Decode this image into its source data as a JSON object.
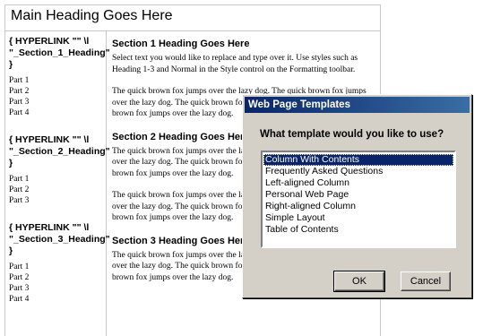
{
  "document": {
    "main_heading": "Main Heading Goes Here",
    "nav_groups": [
      {
        "link": "{ HYPERLINK \"\" \\l \"_Section_1_Heading\" }",
        "parts": [
          "Part 1",
          "Part 2",
          "Part 3",
          "Part 4"
        ]
      },
      {
        "link": "{ HYPERLINK \"\" \\l \"_Section_2_Heading\" }",
        "parts": [
          "Part 1",
          "Part 2",
          "Part 3"
        ]
      },
      {
        "link": "{ HYPERLINK \"\" \\l \"_Section_3_Heading\" }",
        "parts": [
          "Part 1",
          "Part 2",
          "Part 3",
          "Part 4"
        ]
      }
    ],
    "sections": [
      {
        "heading": "Section 1 Heading Goes Here",
        "paragraphs": [
          "Select text you would like to replace and type over it. Use styles such as Heading 1-3 and Normal in the Style control on the Formatting toolbar.",
          "The quick brown fox jumps over the lazy dog. The quick brown fox jumps over the lazy dog. The quick brown fox jumps over the lazy dog. The quick brown fox jumps over the lazy dog."
        ]
      },
      {
        "heading": "Section 2 Heading Goes Here",
        "paragraphs": [
          "The quick brown fox jumps over the lazy dog. The quick brown fox jumps over the lazy dog. The quick brown fox jumps over the lazy dog. The quick brown fox jumps over the lazy dog.",
          "The quick brown fox jumps over the lazy dog. The quick brown fox jumps over the lazy dog. The quick brown fox jumps over the lazy dog. The quick brown fox jumps over the lazy dog."
        ]
      },
      {
        "heading": "Section 3 Heading Goes Here",
        "paragraphs": [
          "The quick brown fox jumps over the lazy dog. The quick brown fox jumps over the lazy dog. The quick brown fox jumps over the lazy dog. The quick brown fox jumps over the lazy dog."
        ]
      }
    ]
  },
  "dialog": {
    "title": "Web Page Templates",
    "prompt": "What template would you like to use?",
    "templates": [
      "Column With Contents",
      "Frequently Asked Questions",
      "Left-aligned Column",
      "Personal Web Page",
      "Right-aligned Column",
      "Simple Layout",
      "Table of Contents"
    ],
    "selected_index": 0,
    "ok_label": "OK",
    "cancel_label": "Cancel"
  },
  "colors": {
    "titlebar_start": "#0a246a",
    "titlebar_end": "#3a6ea5",
    "dialog_face": "#d4d0c8",
    "selection": "#0a246a"
  }
}
